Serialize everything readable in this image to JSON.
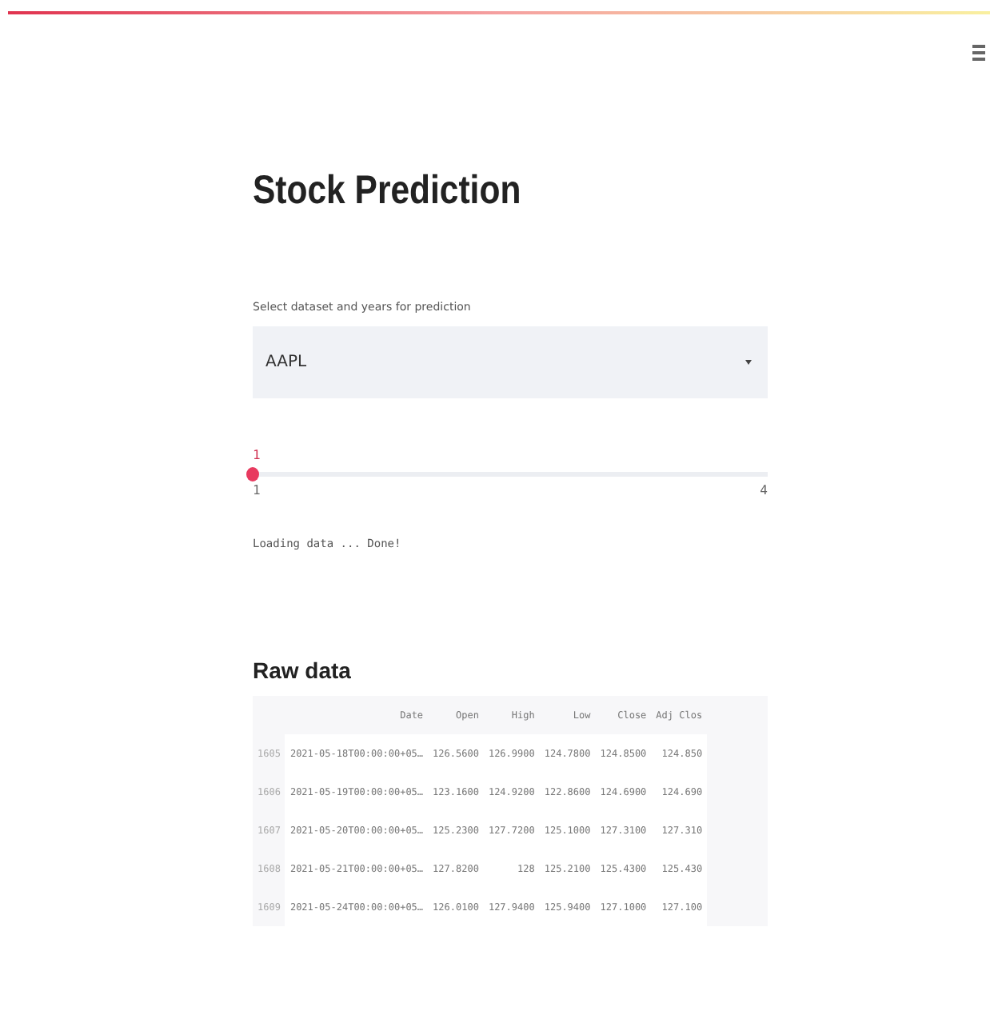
{
  "title": "Stock Prediction",
  "select": {
    "label": "Select dataset and years for prediction",
    "value": "AAPL"
  },
  "slider": {
    "value": "1",
    "min": "1",
    "max": "4",
    "level": 0
  },
  "status": "Loading data ... Done!",
  "raw_data": {
    "heading": "Raw data",
    "columns": [
      "",
      "Date",
      "Open",
      "High",
      "Low",
      "Close",
      "Adj Clos"
    ],
    "rows": [
      [
        "1605",
        "2021-05-18T00:00:00+05…",
        "126.5600",
        "126.9900",
        "124.7800",
        "124.8500",
        "124.850"
      ],
      [
        "1606",
        "2021-05-19T00:00:00+05…",
        "123.1600",
        "124.9200",
        "122.8600",
        "124.6900",
        "124.690"
      ],
      [
        "1607",
        "2021-05-20T00:00:00+05…",
        "125.2300",
        "127.7200",
        "125.1000",
        "127.3100",
        "127.310"
      ],
      [
        "1608",
        "2021-05-21T00:00:00+05…",
        "127.8200",
        "128",
        "125.2100",
        "125.4300",
        "125.430"
      ],
      [
        "1609",
        "2021-05-24T00:00:00+05…",
        "126.0100",
        "127.9400",
        "125.9400",
        "127.1000",
        "127.100"
      ]
    ]
  }
}
